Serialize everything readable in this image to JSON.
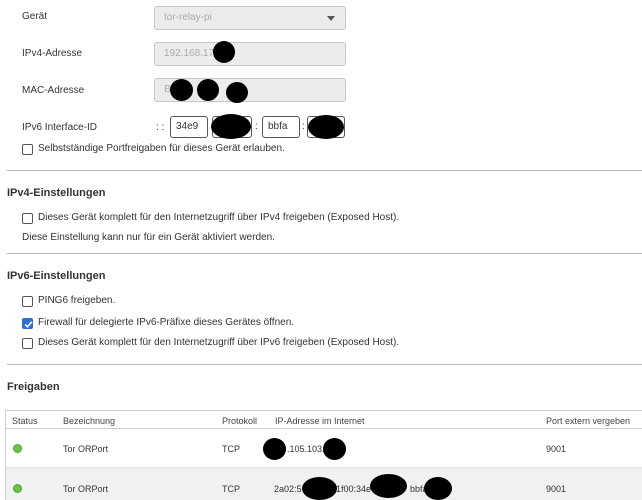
{
  "device": {
    "geraet_label": "Gerät",
    "geraet_value": "tor-relay-pi",
    "ipv4_label": "IPv4-Adresse",
    "ipv4_value": "192.168.178",
    "mac_label": "MAC-Adresse",
    "mac_value": "B",
    "ipv6_label": "IPv6 Interface-ID",
    "ipv6_prefix": ": :",
    "ipv6_seg1": "34e9",
    "ipv6_seg3": "bbfa",
    "ipv6_sep": ":",
    "portfreigabe_label": "Selbstständige Portfreigaben für dieses Gerät erlauben."
  },
  "ipv4": {
    "heading": "IPv4-Einstellungen",
    "exposed_label": "Dieses Gerät komplett für den Internetzugriff über IPv4 freigeben (Exposed Host).",
    "note": "Diese Einstellung kann nur für ein Gerät aktiviert werden."
  },
  "ipv6": {
    "heading": "IPv6-Einstellungen",
    "ping6_label": "PING6 freigeben.",
    "firewall_label": "Firewall für delegierte IPv6-Präfixe dieses Gerätes öffnen.",
    "exposed_label": "Dieses Gerät komplett für den Internetzugriff über IPv6 freigeben (Exposed Host)."
  },
  "freigaben": {
    "heading": "Freigaben",
    "columns": [
      "Status",
      "Bezeichnung",
      "Protokoll",
      "IP-Adresse im Internet",
      "Port extern vergeben"
    ],
    "rows": [
      {
        "name": "Tor ORPort",
        "protocol": "TCP",
        "ip": ".105.103.",
        "port": "9001"
      },
      {
        "name": "Tor ORPort",
        "protocol": "TCP",
        "ip": "2a02:5",
        "ip_mid": "1f00:34e",
        "ip_end": "bbfa",
        "port": "9001"
      }
    ]
  },
  "colors": {
    "status_ok": "#6cc24a",
    "checkbox_checked": "#2f6fcf"
  }
}
